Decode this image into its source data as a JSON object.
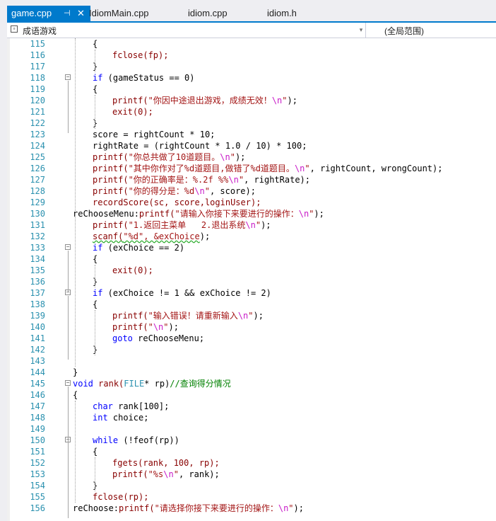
{
  "tabs": [
    {
      "label": "game.cpp",
      "active": true
    },
    {
      "label": "IdiomMain.cpp",
      "active": false
    },
    {
      "label": "idiom.cpp",
      "active": false
    },
    {
      "label": "idiom.h",
      "active": false
    }
  ],
  "nav": {
    "scope_left": "成语游戏",
    "scope_right": "(全局范围)"
  },
  "colors": {
    "accent": "#007acc",
    "keyword": "#0000ff",
    "string": "#a31515",
    "comment": "#008000",
    "line_number": "#2b91af"
  },
  "code": [
    {
      "n": "115",
      "indent": 1,
      "parts": [
        {
          "t": "{"
        }
      ]
    },
    {
      "n": "116",
      "indent": 2,
      "parts": [
        {
          "t": "fclose(fp);",
          "c": "fn"
        }
      ]
    },
    {
      "n": "117",
      "indent": 1,
      "parts": [
        {
          "t": "}"
        }
      ]
    },
    {
      "n": "118",
      "indent": 1,
      "fold": true,
      "parts": [
        {
          "t": "if",
          "c": "kw"
        },
        {
          "t": " (gameStatus == 0)"
        }
      ]
    },
    {
      "n": "119",
      "indent": 1,
      "parts": [
        {
          "t": "{"
        }
      ]
    },
    {
      "n": "120",
      "indent": 2,
      "parts": [
        {
          "t": "printf(",
          "c": "fn"
        },
        {
          "t": "\"你因中途退出游戏，成绩无效！",
          "c": "str"
        },
        {
          "t": "\\n",
          "c": "esc"
        },
        {
          "t": "\"",
          "c": "str"
        },
        {
          "t": ");"
        }
      ]
    },
    {
      "n": "121",
      "indent": 2,
      "parts": [
        {
          "t": "exit(0);",
          "c": "fn"
        }
      ]
    },
    {
      "n": "122",
      "indent": 1,
      "parts": [
        {
          "t": "}"
        }
      ]
    },
    {
      "n": "123",
      "indent": 1,
      "parts": [
        {
          "t": "score = rightCount * 10;"
        }
      ]
    },
    {
      "n": "124",
      "indent": 1,
      "parts": [
        {
          "t": "rightRate = (rightCount * 1.0 / 10) * 100;"
        }
      ]
    },
    {
      "n": "125",
      "indent": 1,
      "parts": [
        {
          "t": "printf(",
          "c": "fn"
        },
        {
          "t": "\"你总共做了10道题目。",
          "c": "str"
        },
        {
          "t": "\\n",
          "c": "esc"
        },
        {
          "t": "\"",
          "c": "str"
        },
        {
          "t": ");"
        }
      ]
    },
    {
      "n": "126",
      "indent": 1,
      "parts": [
        {
          "t": "printf(",
          "c": "fn"
        },
        {
          "t": "\"其中你作对了%d道题目,做错了%d道题目。",
          "c": "str"
        },
        {
          "t": "\\n",
          "c": "esc"
        },
        {
          "t": "\"",
          "c": "str"
        },
        {
          "t": ", rightCount, wrongCount);"
        }
      ]
    },
    {
      "n": "127",
      "indent": 1,
      "parts": [
        {
          "t": "printf(",
          "c": "fn"
        },
        {
          "t": "\"你的正确率是：%.2f %%",
          "c": "str"
        },
        {
          "t": "\\n",
          "c": "esc"
        },
        {
          "t": "\"",
          "c": "str"
        },
        {
          "t": ", rightRate);"
        }
      ]
    },
    {
      "n": "128",
      "indent": 1,
      "parts": [
        {
          "t": "printf(",
          "c": "fn"
        },
        {
          "t": "\"你的得分是：%d",
          "c": "str"
        },
        {
          "t": "\\n",
          "c": "esc"
        },
        {
          "t": "\"",
          "c": "str"
        },
        {
          "t": ", score);"
        }
      ]
    },
    {
      "n": "129",
      "indent": 1,
      "parts": [
        {
          "t": "recordScore(sc, score,loginUser);",
          "c": "fn"
        }
      ]
    },
    {
      "n": "130",
      "indent": 0,
      "parts": [
        {
          "t": "reChooseMenu:"
        },
        {
          "t": "printf(",
          "c": "fn"
        },
        {
          "t": "\"请输入你接下来要进行的操作：",
          "c": "str"
        },
        {
          "t": "\\n",
          "c": "esc"
        },
        {
          "t": "\"",
          "c": "str"
        },
        {
          "t": ");"
        }
      ]
    },
    {
      "n": "131",
      "indent": 1,
      "parts": [
        {
          "t": "printf(",
          "c": "fn"
        },
        {
          "t": "\"1.返回主菜单   2.退出系统",
          "c": "str"
        },
        {
          "t": "\\n",
          "c": "esc"
        },
        {
          "t": "\"",
          "c": "str"
        },
        {
          "t": ");"
        }
      ]
    },
    {
      "n": "132",
      "indent": 1,
      "parts": [
        {
          "t": "scanf(",
          "c": "fn",
          "ul": true
        },
        {
          "t": "\"%d\", &exChoice",
          "c": "str",
          "ul": true
        },
        {
          "t": ");"
        }
      ]
    },
    {
      "n": "133",
      "indent": 1,
      "fold": true,
      "parts": [
        {
          "t": "if",
          "c": "kw"
        },
        {
          "t": " (exChoice == 2)"
        }
      ]
    },
    {
      "n": "134",
      "indent": 1,
      "parts": [
        {
          "t": "{"
        }
      ]
    },
    {
      "n": "135",
      "indent": 2,
      "parts": [
        {
          "t": "exit(0);",
          "c": "fn"
        }
      ]
    },
    {
      "n": "136",
      "indent": 1,
      "parts": [
        {
          "t": "}"
        }
      ]
    },
    {
      "n": "137",
      "indent": 1,
      "fold": true,
      "parts": [
        {
          "t": "if",
          "c": "kw"
        },
        {
          "t": " (exChoice != 1 && exChoice != 2)"
        }
      ]
    },
    {
      "n": "138",
      "indent": 1,
      "parts": [
        {
          "t": "{"
        }
      ]
    },
    {
      "n": "139",
      "indent": 2,
      "parts": [
        {
          "t": "printf(",
          "c": "fn"
        },
        {
          "t": "\"输入错误！请重新输入",
          "c": "str"
        },
        {
          "t": "\\n",
          "c": "esc"
        },
        {
          "t": "\"",
          "c": "str"
        },
        {
          "t": ");"
        }
      ]
    },
    {
      "n": "140",
      "indent": 2,
      "parts": [
        {
          "t": "printf(",
          "c": "fn"
        },
        {
          "t": "\"",
          "c": "str"
        },
        {
          "t": "\\n",
          "c": "esc"
        },
        {
          "t": "\"",
          "c": "str"
        },
        {
          "t": ");"
        }
      ]
    },
    {
      "n": "141",
      "indent": 2,
      "parts": [
        {
          "t": "goto",
          "c": "kw"
        },
        {
          "t": " reChooseMenu;"
        }
      ]
    },
    {
      "n": "142",
      "indent": 1,
      "parts": [
        {
          "t": "}"
        }
      ]
    },
    {
      "n": "143",
      "indent": 0,
      "parts": [
        {
          "t": ""
        }
      ]
    },
    {
      "n": "144",
      "indent": 0,
      "parts": [
        {
          "t": "}"
        }
      ]
    },
    {
      "n": "145",
      "indent": 0,
      "fold": true,
      "parts": [
        {
          "t": "void",
          "c": "kw"
        },
        {
          "t": " "
        },
        {
          "t": "rank(",
          "c": "fn"
        },
        {
          "t": "FILE",
          "c": "typ"
        },
        {
          "t": "* rp)"
        },
        {
          "t": "//查询得分情况",
          "c": "cm"
        }
      ]
    },
    {
      "n": "146",
      "indent": 0,
      "parts": [
        {
          "t": "{"
        }
      ]
    },
    {
      "n": "147",
      "indent": 1,
      "parts": [
        {
          "t": "char",
          "c": "kw"
        },
        {
          "t": " rank[100];"
        }
      ]
    },
    {
      "n": "148",
      "indent": 1,
      "parts": [
        {
          "t": "int",
          "c": "kw"
        },
        {
          "t": " choice;"
        }
      ]
    },
    {
      "n": "149",
      "indent": 0,
      "parts": [
        {
          "t": ""
        }
      ]
    },
    {
      "n": "150",
      "indent": 1,
      "fold": true,
      "parts": [
        {
          "t": "while",
          "c": "kw"
        },
        {
          "t": " (!feof(rp))"
        }
      ]
    },
    {
      "n": "151",
      "indent": 1,
      "parts": [
        {
          "t": "{"
        }
      ]
    },
    {
      "n": "152",
      "indent": 2,
      "parts": [
        {
          "t": "fgets(rank, 100, rp);",
          "c": "fn"
        }
      ]
    },
    {
      "n": "153",
      "indent": 2,
      "parts": [
        {
          "t": "printf(",
          "c": "fn"
        },
        {
          "t": "\"%s",
          "c": "str"
        },
        {
          "t": "\\n",
          "c": "esc"
        },
        {
          "t": "\"",
          "c": "str"
        },
        {
          "t": ", rank);"
        }
      ]
    },
    {
      "n": "154",
      "indent": 1,
      "parts": [
        {
          "t": "}"
        }
      ]
    },
    {
      "n": "155",
      "indent": 1,
      "parts": [
        {
          "t": "fclose(rp);",
          "c": "fn"
        }
      ]
    },
    {
      "n": "156",
      "indent": 0,
      "parts": [
        {
          "t": "reChoose:"
        },
        {
          "t": "printf(",
          "c": "fn"
        },
        {
          "t": "\"请选择你接下来要进行的操作：",
          "c": "str"
        },
        {
          "t": "\\n",
          "c": "esc"
        },
        {
          "t": "\"",
          "c": "str"
        },
        {
          "t": ");"
        }
      ]
    }
  ]
}
